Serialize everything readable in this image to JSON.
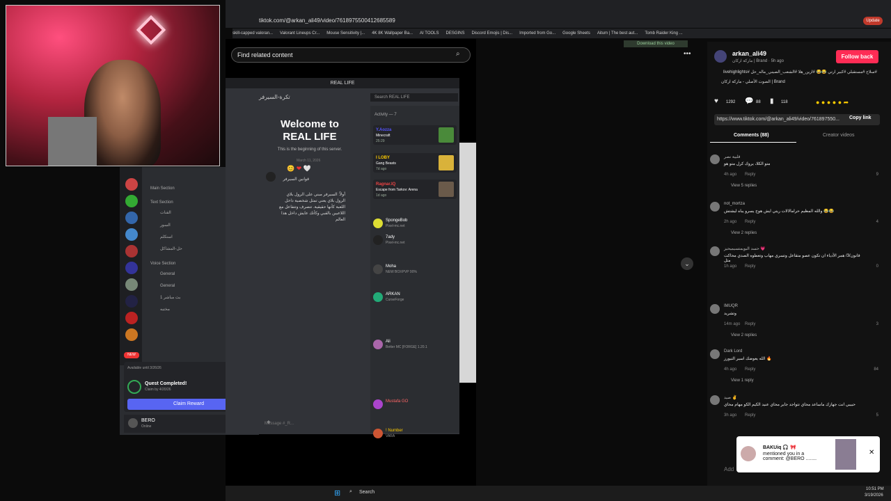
{
  "browser": {
    "url": "tiktok.com/@arkan_ali49/video/7618975500412685589",
    "bookmarks": [
      "skill-capped valoran...",
      "Valorant Lineups Cr...",
      "Mouse Sensitivity |...",
      "4K 8K Wallpaper Ba...",
      "AI TOOLS",
      "DESGINS",
      "Discord Emojis | Dis...",
      "Imported from Go...",
      "Google Sheets",
      "Aitum | The best aut...",
      "Tomb Raider King ..."
    ],
    "update_label": "Update",
    "download_label": "Download this video"
  },
  "tiktok": {
    "search_placeholder": "Find related content",
    "author": "arkan_ali49",
    "author_meta": "ماركة اركان | Brand · 5h ago",
    "caption": "#سلاح #مستقبلي #كبير ارتي 😂😂 #ارين_هلا #الشعب_الصيني_ماله_حل #livehighlights",
    "music": "الصوت الأصلي - ماركة اركان | Brand",
    "follow_label": "Follow back",
    "likes": "1292",
    "comments_count": "88",
    "saves": "118",
    "url": "https://www.tiktok.com/@arkan_ali49/video/761897550...",
    "copy_label": "Copy link",
    "tab_comments": "Comments (88)",
    "tab_creator": "Creator videos",
    "reply_label": "Reply",
    "add_placeholder": "Add",
    "comments": [
      {
        "name": "قلبية نصر",
        "text": "متو الكلا، يروك كرل متو هو",
        "time": "4h ago",
        "likes": "9",
        "replies": "View 5 replies"
      },
      {
        "name": "not_mortza",
        "text": "والله المظيم حرامالالات ريتي ايش هوج يسرو يباه ليشتش 😂😂",
        "time": "2h ago",
        "likes": "4",
        "replies": "View 2 replies"
      },
      {
        "name": "حسد البويمتسيميحيز 💗",
        "text": "قانون/3/ همر الأدياء ان تكون عصو متقاعل وتسري مهاب وتعطوه الصدي محاكت مثل",
        "time": "1h ago",
        "likes": "0",
        "replies": ""
      },
      {
        "name": "IMUQR",
        "text": "وتشريد",
        "time": "14m ago",
        "likes": "3",
        "replies": "View 2 replies"
      },
      {
        "name": "Dark Lord",
        "text": "الله يعوضك اسير التيورز 🔥",
        "time": "4h ago",
        "likes": "84",
        "replies": "View 1 reply"
      },
      {
        "name": "صيد ✌",
        "text": "حبيبي انت جهازك ماساعد محاي تتواجد جاير محاي عنيد الكيم الكو مهام محاي",
        "time": "3h ago",
        "likes": "5",
        "replies": ""
      }
    ],
    "notif_name": "BAKUiq 🎧 🎀",
    "notif_text": "mentioned you in a comment: @BERO ........"
  },
  "discord": {
    "title": "REAL LIFE",
    "channel": "تكرة-السيرفر",
    "search_placeholder": "Search REAL LIFE",
    "welcome_line1": "Welcome to",
    "welcome_line2": "REAL LIFE",
    "welcome_line3": "This is the beginning of this server.",
    "date": "March 11, 2026",
    "rules_title": "قوانين السيرفر",
    "rules_body": "أولاً: السيرفر مبني على الرول بلاي الرول بلاي يعني تمثل شخصية داخل اللعبة كأنها حقيقية. تتصرف وتتفاعل مع اللاعبين بالقبي وكأنك عايش داخل هذا العالم",
    "msg_placeholder": "Message #_R...",
    "activity_label": "Activity — 7",
    "activity": [
      {
        "name": "Minecraft",
        "status": "25:29",
        "user": "Y.Aozza"
      },
      {
        "name": "Gang Beasts",
        "status": "7d ago",
        "user": "I LOBY"
      },
      {
        "name": "Escape from Tarkov: Arena",
        "status": "1d ago",
        "user": "Ragnar.IQ"
      }
    ],
    "members": [
      {
        "name": "SpongeBob",
        "status": "Pixel-mc.net"
      },
      {
        "name": "7ady",
        "status": "Pixel-mc.net"
      },
      {
        "name": "Moha",
        "status": "NEW BOXPVP 90%"
      },
      {
        "name": "ARKAN",
        "status": "CurseForge"
      },
      {
        "name": "Ali",
        "status": "Better MC [FORGE] 1.20.1"
      },
      {
        "name": "Mustafa GO",
        "status": ""
      },
      {
        "name": "! Number",
        "status": "VARA"
      }
    ],
    "sections": {
      "main": "Main Section",
      "text": "Text Section",
      "voice": "Voice Section"
    },
    "channels": [
      "القنات",
      "السور",
      "استكلم",
      "حل-المشاكل"
    ],
    "voice": [
      "General",
      "General",
      "بث مباشر 1",
      "مختبه"
    ],
    "quest_avail": "Available until 3/26/26",
    "quest_title": "Quest Completed!",
    "quest_sub": "Claim by 4/20/26",
    "claim_label": "Claim Reward",
    "user_name": "BERO",
    "user_status": "Online",
    "new_badge": "NEW"
  },
  "taskbar": {
    "search": "Search",
    "time": "10:51 PM",
    "date": "3/19/2026"
  },
  "colors": {
    "tiktok_red": "#fe2c55",
    "discord_blurple": "#5865f2"
  }
}
